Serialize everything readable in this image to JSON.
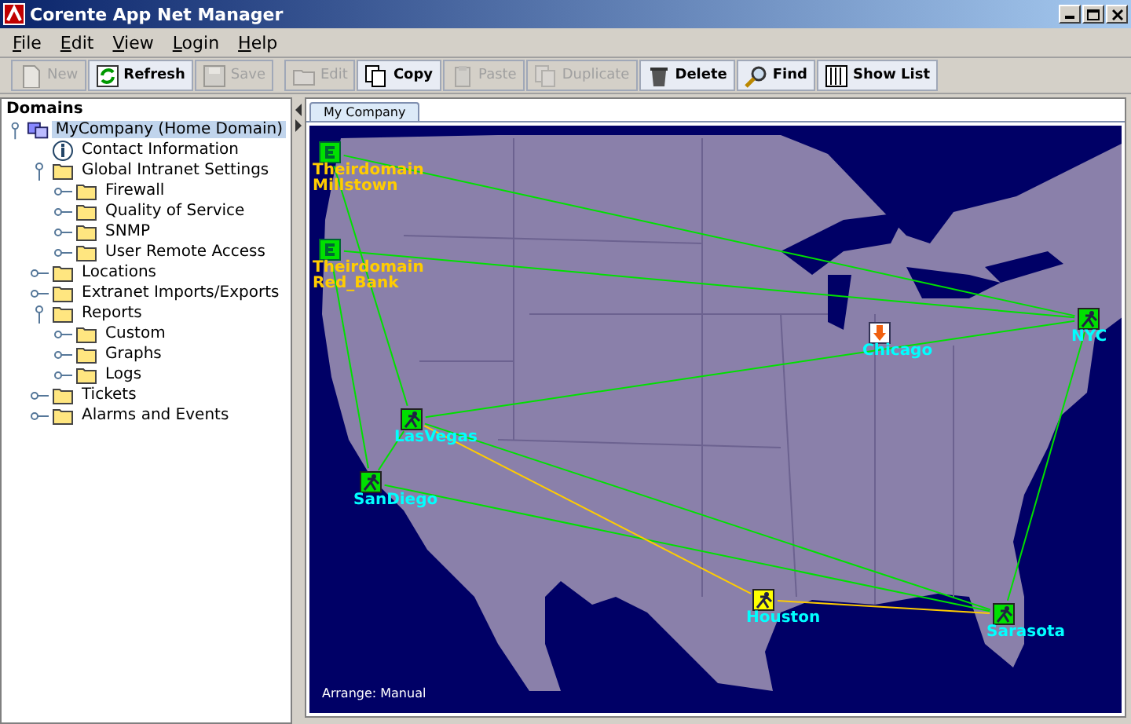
{
  "window": {
    "title": "Corente App Net Manager"
  },
  "menu": [
    {
      "label": "File"
    },
    {
      "label": "Edit"
    },
    {
      "label": "View"
    },
    {
      "label": "Login"
    },
    {
      "label": "Help"
    }
  ],
  "toolbar": [
    {
      "kind": "new",
      "label": "New",
      "disabled": true
    },
    {
      "kind": "refresh",
      "label": "Refresh",
      "disabled": false
    },
    {
      "kind": "save",
      "label": "Save",
      "disabled": true
    },
    {
      "kind": "edit",
      "label": "Edit",
      "disabled": true
    },
    {
      "kind": "copy",
      "label": "Copy",
      "disabled": false
    },
    {
      "kind": "paste",
      "label": "Paste",
      "disabled": true
    },
    {
      "kind": "duplicate",
      "label": "Duplicate",
      "disabled": true
    },
    {
      "kind": "delete",
      "label": "Delete",
      "disabled": false
    },
    {
      "kind": "find",
      "label": "Find",
      "disabled": false
    },
    {
      "kind": "list",
      "label": "Show List",
      "disabled": false
    }
  ],
  "sidebar": {
    "title": "Domains",
    "tree": [
      {
        "kind": "domain",
        "label": "MyCompany (Home Domain)",
        "expanded": true,
        "selected": true,
        "children": [
          {
            "kind": "info",
            "label": "Contact Information",
            "selected": false
          },
          {
            "kind": "folder",
            "label": "Global Intranet Settings",
            "expanded": true,
            "selected": false,
            "children": [
              {
                "kind": "folder",
                "label": "Firewall",
                "expanded": false,
                "selected": false
              },
              {
                "kind": "folder",
                "label": "Quality of Service",
                "expanded": false,
                "selected": false
              },
              {
                "kind": "folder",
                "label": "SNMP",
                "expanded": false,
                "selected": false
              },
              {
                "kind": "folder",
                "label": "User Remote Access",
                "expanded": false,
                "selected": false
              }
            ]
          },
          {
            "kind": "folder",
            "label": "Locations",
            "expanded": false,
            "selected": false
          },
          {
            "kind": "folder",
            "label": "Extranet Imports/Exports",
            "expanded": false,
            "selected": false
          },
          {
            "kind": "folder",
            "label": "Reports",
            "expanded": true,
            "selected": false,
            "children": [
              {
                "kind": "folder",
                "label": "Custom",
                "expanded": false,
                "selected": false
              },
              {
                "kind": "folder",
                "label": "Graphs",
                "expanded": false,
                "selected": false
              },
              {
                "kind": "folder",
                "label": "Logs",
                "expanded": false,
                "selected": false
              }
            ]
          },
          {
            "kind": "folder",
            "label": "Tickets",
            "expanded": false,
            "selected": false
          },
          {
            "kind": "folder",
            "label": "Alarms and Events",
            "expanded": false,
            "selected": false
          }
        ]
      }
    ]
  },
  "tabs": [
    {
      "label": "My Company",
      "selected": true
    }
  ],
  "map": {
    "arrange": "Arrange: Manual",
    "nodes": [
      {
        "kind": "domain",
        "label": "Theirdomain Millstown",
        "color": "#00e000"
      },
      {
        "kind": "domain",
        "label": "Theirdomain Red_Bank",
        "color": "#00e000"
      },
      {
        "kind": "site",
        "label": "NYC",
        "color": "#00e000"
      },
      {
        "kind": "alert",
        "label": "Chicago",
        "color": "#ffffff"
      },
      {
        "kind": "site",
        "label": "LasVegas",
        "color": "#00e000"
      },
      {
        "kind": "site",
        "label": "SanDiego",
        "color": "#00e000"
      },
      {
        "kind": "site",
        "label": "Houston",
        "color": "#ffff00"
      },
      {
        "kind": "site",
        "label": "Sarasota",
        "color": "#00e000"
      }
    ],
    "links": [
      {
        "color": "#00e000"
      },
      {
        "color": "#00e000"
      },
      {
        "color": "#00e000"
      },
      {
        "color": "#00e000"
      },
      {
        "color": "#00e000"
      },
      {
        "color": "#00e000"
      },
      {
        "color": "#00e000"
      },
      {
        "color": "#00e000"
      },
      {
        "color": "#00e000"
      },
      {
        "color": "#ffcc00"
      },
      {
        "color": "#ffcc00"
      }
    ]
  }
}
